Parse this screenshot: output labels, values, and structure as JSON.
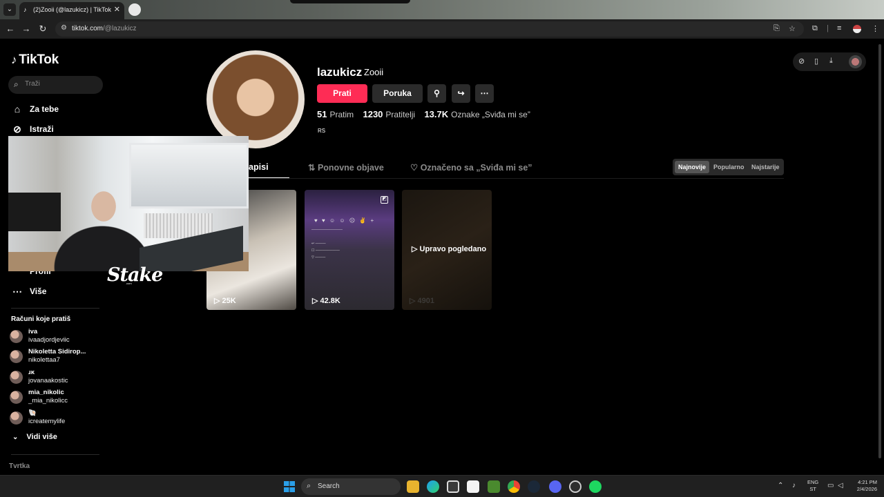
{
  "browser": {
    "tab_title": "(2)Zooii (@lazukicz) | TikTok",
    "url_host": "tiktok.com",
    "url_path": "/@lazukicz"
  },
  "sidebar": {
    "logo": "TikTok",
    "search_placeholder": "Traži",
    "nav": [
      {
        "label": "Za tebe",
        "icon": "home-icon"
      },
      {
        "label": "Istraži",
        "icon": "compass-icon"
      },
      {
        "label": "Profil",
        "icon": "profile-icon"
      },
      {
        "label": "Više",
        "icon": "more-icon"
      }
    ],
    "following_title": "Računi koje pratiš",
    "following": [
      {
        "name": "iva",
        "handle": "ivaadjordjeviic"
      },
      {
        "name": "Nikoletta Sidirop...",
        "handle": "nikolettaa7"
      },
      {
        "name": "ɹĸ",
        "handle": "jovanaakostic"
      },
      {
        "name": "mia_nikolic",
        "handle": "_mia_nikolicc"
      },
      {
        "name": "🐚",
        "handle": "icreatemylife"
      }
    ],
    "see_more": "Vidi više",
    "company": "Tvrtka"
  },
  "profile": {
    "username": "lazukicz",
    "nickname": "Zooii",
    "follow_button": "Prati",
    "message_button": "Poruka",
    "following_count": "51",
    "following_label": "Pratim",
    "followers_count": "1230",
    "followers_label": "Pratitelji",
    "likes_count": "13.7K",
    "likes_label": "Oznake „Sviđa mi se”",
    "bio": "RS"
  },
  "tabs": [
    {
      "label": "Videozapisi",
      "active": true
    },
    {
      "label": "Ponovne objave",
      "active": false
    },
    {
      "label": "Označeno sa „Sviđa mi se”",
      "active": false
    }
  ],
  "sort": [
    {
      "label": "Najnovije",
      "active": true
    },
    {
      "label": "Popularno",
      "active": false
    },
    {
      "label": "Najstarije",
      "active": false
    }
  ],
  "videos": [
    {
      "views": "25K"
    },
    {
      "views": "42.8K",
      "photo": true
    },
    {
      "views": "4901",
      "overlay": "Upravo pogledano"
    }
  ],
  "overlay": {
    "brand": "Stake",
    "brand_sub": ".com"
  },
  "taskbar": {
    "search": "Search",
    "lang_line1": "ENG",
    "lang_line2": "ST",
    "time": "4:21 PM",
    "date": "2/4/2026"
  },
  "colors": {
    "accent": "#fe2c55",
    "background": "#000000"
  }
}
